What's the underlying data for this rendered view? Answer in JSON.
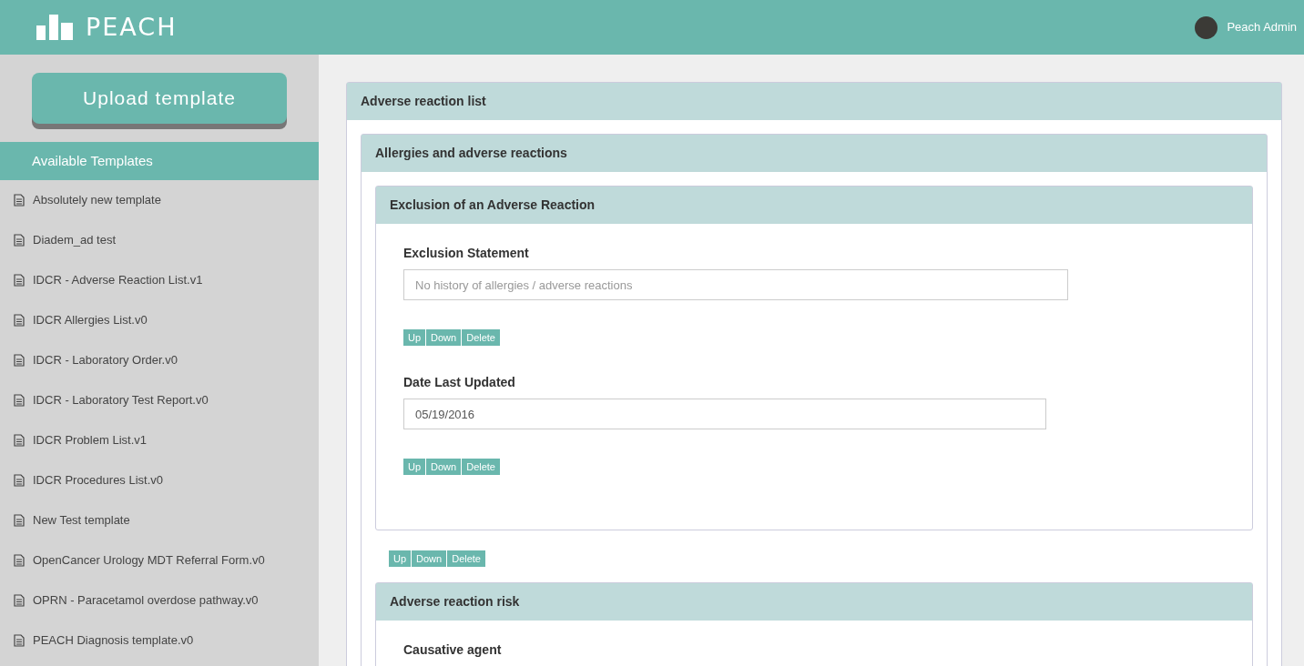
{
  "header": {
    "logo": "PEACH",
    "user": "Peach Admin"
  },
  "sidebar": {
    "upload_button": "Upload template",
    "heading": "Available Templates",
    "templates": [
      "Absolutely new template",
      "Diadem_ad test",
      "IDCR - Adverse Reaction List.v1",
      "IDCR Allergies List.v0",
      "IDCR - Laboratory Order.v0",
      "IDCR - Laboratory Test Report.v0",
      "IDCR Problem List.v1",
      "IDCR Procedures List.v0",
      "New Test template",
      "OpenCancer Urology MDT Referral Form.v0",
      "OPRN - Paracetamol overdose pathway.v0",
      "PEACH Diagnosis template.v0"
    ]
  },
  "form": {
    "title": "Adverse reaction list",
    "sections": [
      {
        "title": "Allergies and adverse reactions",
        "groups": [
          {
            "title": "Exclusion of an Adverse Reaction",
            "fields": [
              {
                "kind": "text",
                "label": "Exclusion Statement",
                "placeholder": "No history of allergies / adverse reactions",
                "buttons": [
                  "Up",
                  "Down",
                  "Delete"
                ]
              },
              {
                "kind": "date",
                "label": "Date Last Updated",
                "value": "05/19/2016",
                "buttons": [
                  "Up",
                  "Down",
                  "Delete"
                ]
              }
            ],
            "buttons": [
              "Up",
              "Down",
              "Delete"
            ]
          },
          {
            "title": "Adverse reaction risk",
            "fields": [
              {
                "kind": "text",
                "label": "Causative agent"
              }
            ]
          }
        ]
      }
    ]
  }
}
